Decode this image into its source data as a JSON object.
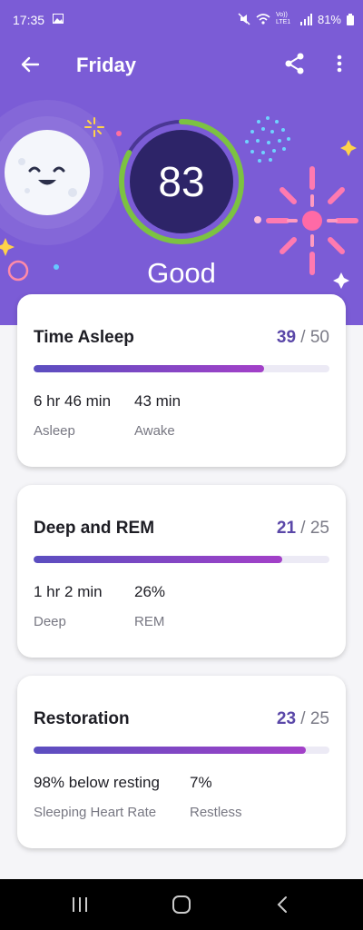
{
  "status": {
    "time": "17:35",
    "battery": "81%",
    "network": "Vo)) LTE1"
  },
  "header": {
    "title": "Friday"
  },
  "score": {
    "value": "83",
    "label": "Good",
    "fraction": 0.83
  },
  "cards": [
    {
      "title": "Time Asleep",
      "score": "39",
      "max": "/ 50",
      "fraction": 0.78,
      "metrics": [
        {
          "value": "6 hr 46 min",
          "label": "Asleep"
        },
        {
          "value": "43 min",
          "label": "Awake"
        }
      ]
    },
    {
      "title": "Deep and REM",
      "score": "21",
      "max": "/ 25",
      "fraction": 0.84,
      "metrics": [
        {
          "value": "1 hr 2 min",
          "label": "Deep"
        },
        {
          "value": "26%",
          "label": "REM"
        }
      ]
    },
    {
      "title": "Restoration",
      "score": "23",
      "max": "/ 25",
      "fraction": 0.92,
      "metrics": [
        {
          "value": "98% below resting",
          "label": "Sleeping Heart Rate"
        },
        {
          "value": "7%",
          "label": "Restless"
        }
      ]
    }
  ],
  "colors": {
    "hero": "#7b5cd6",
    "ring": "#7cc242",
    "scoreNum": "#5a47a8"
  }
}
